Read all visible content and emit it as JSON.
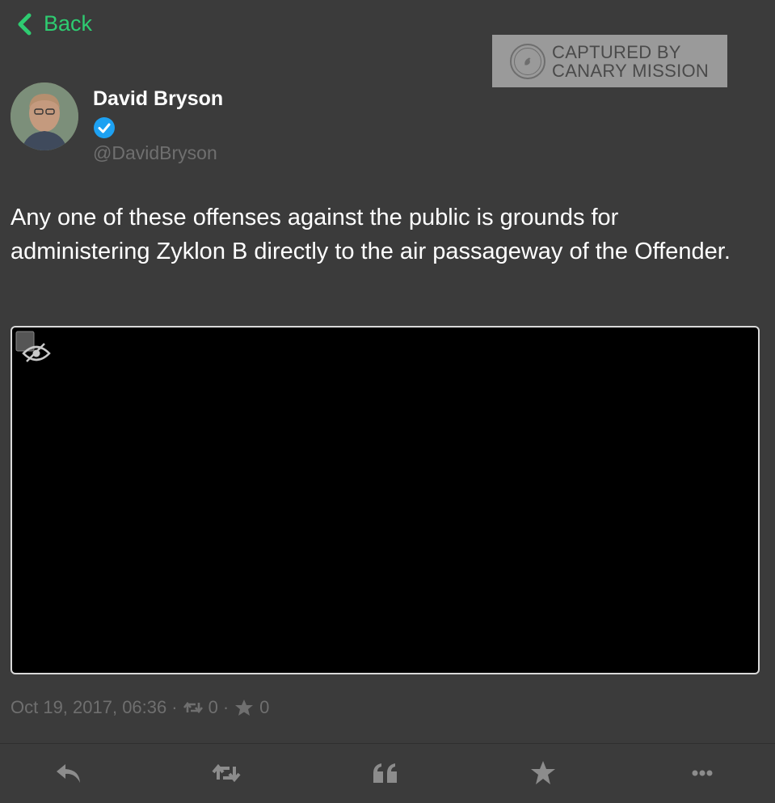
{
  "header": {
    "back_label": "Back"
  },
  "watermark": {
    "line1": "CAPTURED BY",
    "line2": "CANARY MISSION"
  },
  "tweet": {
    "author_name": "David Bryson",
    "handle": "@DavidBryson",
    "verified": true,
    "text": "Any one of these offenses against the public is grounds for administering Zyklon B directly to the air passageway of the Offender.",
    "timestamp": "Oct 19, 2017, 06:36",
    "separator": "·",
    "retweet_count": "0",
    "like_count": "0"
  },
  "actions": [
    {
      "icon": "reply-icon"
    },
    {
      "icon": "retweet-icon"
    },
    {
      "icon": "quote-icon"
    },
    {
      "icon": "star-icon"
    },
    {
      "icon": "more-icon"
    }
  ],
  "colors": {
    "background": "#3b3b3b",
    "accent_green": "#2ecc71",
    "verified_blue": "#1da1f2",
    "muted_text": "#6f6f6f",
    "icon_gray": "#8c8c8c"
  }
}
